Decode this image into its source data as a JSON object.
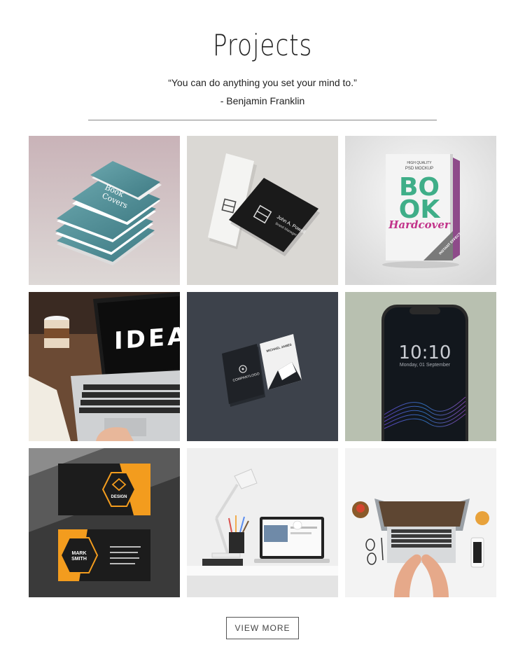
{
  "section": {
    "title": "Projects",
    "quote": "“You can do anything you set your mind to.”",
    "author": "- Benjamin Franklin"
  },
  "projects": [
    {
      "name": "book-covers-mockup",
      "texts": {
        "l1": "Book",
        "l2": "Covers"
      }
    },
    {
      "name": "white-black-business-cards",
      "texts": {
        "person": "John A. Powell",
        "role": "Brand Manager"
      }
    },
    {
      "name": "hardcover-book-mockup",
      "texts": {
        "top": "HIGH QUALITY",
        "psd": "PSD MOCKUP",
        "bo": "BO",
        "ok": "OK",
        "hard": "Hardcover",
        "corner": "INSTANT EFFECT"
      }
    },
    {
      "name": "laptop-ideas",
      "texts": {
        "screen": "IDEAS"
      }
    },
    {
      "name": "dark-business-cards",
      "texts": {
        "company": "COMPANYLOGO",
        "person": "MICHAEL JAMES"
      }
    },
    {
      "name": "smartphone-mockup",
      "texts": {
        "time": "10:10",
        "date": "Monday, 01 September"
      }
    },
    {
      "name": "orange-business-cards",
      "texts": {
        "logo": "DESIGN",
        "name1": "MARK",
        "name2": "SMITH"
      }
    },
    {
      "name": "desk-lamp-workspace",
      "texts": {}
    },
    {
      "name": "laptop-top-view",
      "texts": {}
    }
  ],
  "button": {
    "label": "VIEW MORE"
  }
}
